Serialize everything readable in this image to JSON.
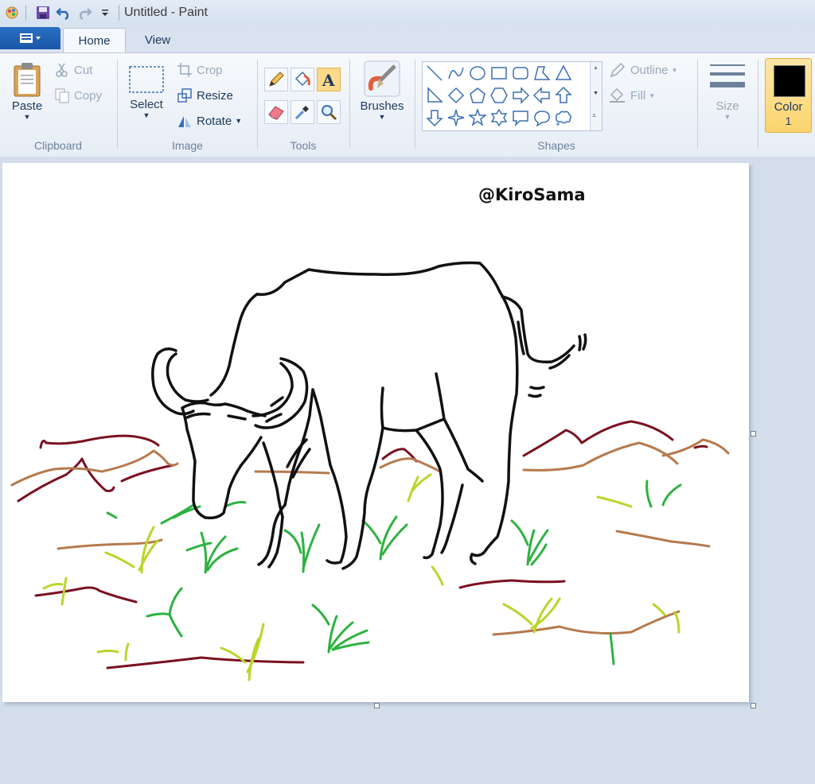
{
  "window": {
    "title": "Untitled - Paint"
  },
  "tabs": [
    {
      "label": "Home"
    },
    {
      "label": "View"
    }
  ],
  "clipboard": {
    "group_label": "Clipboard",
    "paste": "Paste",
    "cut": "Cut",
    "copy": "Copy"
  },
  "image": {
    "group_label": "Image",
    "select": "Select",
    "crop": "Crop",
    "resize": "Resize",
    "rotate": "Rotate"
  },
  "tools": {
    "group_label": "Tools"
  },
  "brushes": {
    "label": "Brushes"
  },
  "shapes": {
    "group_label": "Shapes",
    "outline": "Outline",
    "fill": "Fill"
  },
  "size": {
    "label": "Size"
  },
  "color": {
    "label": "Color",
    "number": "1",
    "value": "#000000"
  },
  "canvas": {
    "watermark": "@KiroSama"
  },
  "colors": {
    "accent": "#fbd46e",
    "brand_blue": "#1a56a8",
    "dark_red": "#7a1020",
    "brown": "#b57a4e",
    "green": "#2db240",
    "light_green": "#b8d62a"
  }
}
